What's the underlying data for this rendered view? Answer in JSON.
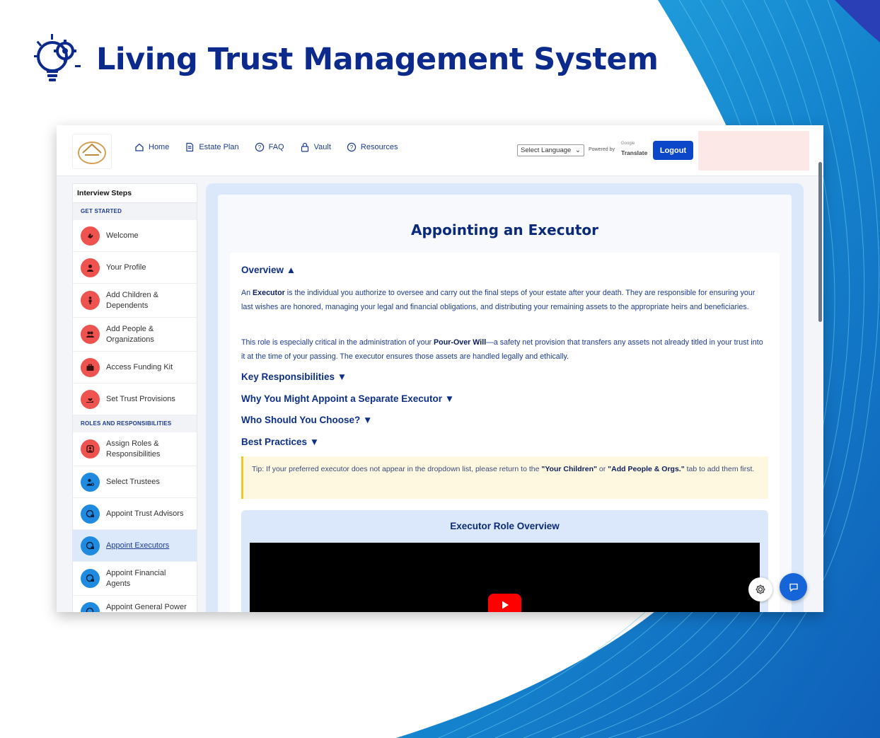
{
  "banner": {
    "title": "Living Trust Management System"
  },
  "nav": {
    "items": [
      {
        "label": "Home",
        "icon": "home-icon"
      },
      {
        "label": "Estate Plan",
        "icon": "document-icon"
      },
      {
        "label": "FAQ",
        "icon": "question-icon"
      },
      {
        "label": "Vault",
        "icon": "lock-icon"
      },
      {
        "label": "Resources",
        "icon": "question-icon"
      }
    ],
    "language_select": "Select Language",
    "powered_by": "Powered by",
    "google": "Google",
    "translate": "Translate",
    "logout": "Logout"
  },
  "sidebar": {
    "title": "Interview Steps",
    "sections": [
      {
        "label": "GET STARTED",
        "items": [
          {
            "label": "Welcome",
            "color": "#ef5350",
            "icon": "hand-wave-icon"
          },
          {
            "label": "Your Profile",
            "color": "#ef5350",
            "icon": "user-icon"
          },
          {
            "label": "Add Children & Dependents",
            "color": "#ef5350",
            "icon": "child-icon"
          },
          {
            "label": "Add People & Organizations",
            "color": "#ef5350",
            "icon": "people-icon"
          },
          {
            "label": "Access Funding Kit",
            "color": "#ef5350",
            "icon": "briefcase-icon"
          },
          {
            "label": "Set Trust Provisions",
            "color": "#ef5350",
            "icon": "hand-heart-icon"
          }
        ]
      },
      {
        "label": "ROLES AND RESPONSIBILITIES",
        "items": [
          {
            "label": "Assign Roles & Responsibilities",
            "color": "#ef5350",
            "icon": "roles-icon"
          },
          {
            "label": "Select Trustees",
            "color": "#1f8be0",
            "icon": "user-key-icon"
          },
          {
            "label": "Appoint Trust Advisors",
            "color": "#1f8be0",
            "icon": "user-badge-icon"
          },
          {
            "label": "Appoint Executors",
            "color": "#1f8be0",
            "icon": "user-badge-icon",
            "active": true
          },
          {
            "label": "Appoint Financial Agents",
            "color": "#1f8be0",
            "icon": "user-badge-icon"
          },
          {
            "label": "Appoint General Power",
            "color": "#1f8be0",
            "icon": "user-badge-icon"
          }
        ]
      }
    ]
  },
  "main": {
    "title": "Appointing an Executor",
    "overview_heading": "Overview ▲",
    "p1_a": "An ",
    "p1_b": "Executor",
    "p1_c": " is the individual you authorize to oversee and carry out the final steps of your estate after your death. They are responsible for ensuring your last wishes are honored, managing your legal and financial obligations, and distributing your remaining assets to the appropriate heirs and beneficiaries.",
    "p2_a": "This role is especially critical in the administration of your ",
    "p2_b": "Pour-Over Will",
    "p2_c": "—a safety net provision that transfers any assets not already titled in your trust into it at the time of your passing. The executor ensures those assets are handled legally and ethically.",
    "collapsed_sections": [
      "Key Responsibilities ▼",
      "Why You Might Appoint a Separate Executor ▼",
      "Who Should You Choose? ▼",
      "Best Practices ▼"
    ],
    "tip_a": "Tip: If your preferred executor does not appear in the dropdown list, please return to the ",
    "tip_b": "\"Your Children\"",
    "tip_c": " or ",
    "tip_d": "\"Add People & Orgs.\"",
    "tip_e": " tab to add them first.",
    "video_title": "Executor Role Overview"
  },
  "colors": {
    "accent": "#0d47c9",
    "brand": "#0b2a8c",
    "red": "#ef5350",
    "blue": "#1f8be0"
  }
}
